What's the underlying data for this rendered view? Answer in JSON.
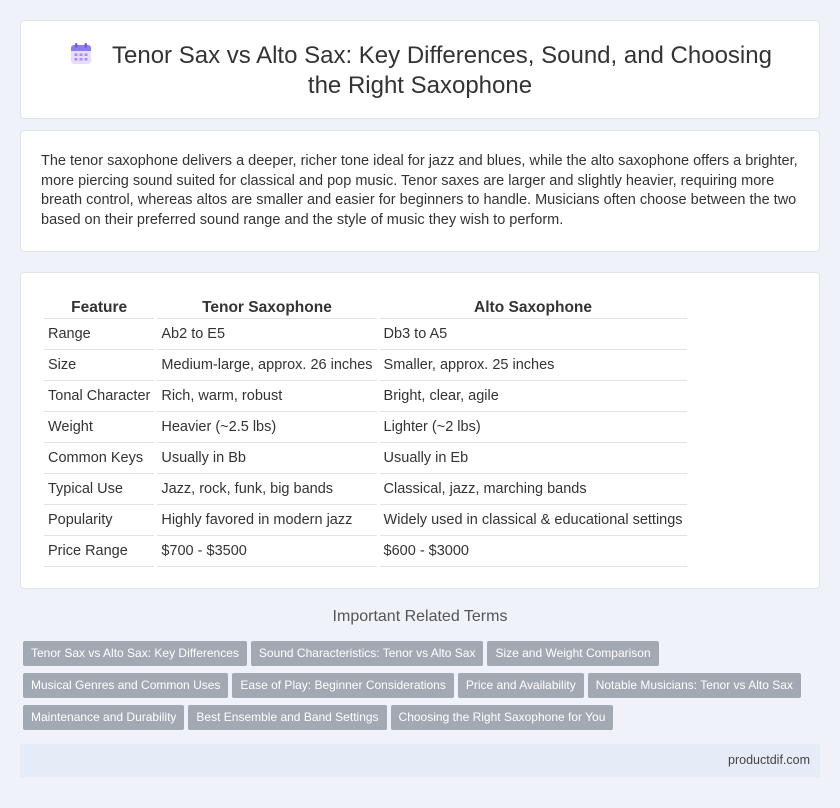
{
  "title": "Tenor Sax vs Alto Sax: Key Differences, Sound, and Choosing the Right Saxophone",
  "intro": "The tenor saxophone delivers a deeper, richer tone ideal for jazz and blues, while the alto saxophone offers a brighter, more piercing sound suited for classical and pop music. Tenor saxes are larger and slightly heavier, requiring more breath control, whereas altos are smaller and easier for beginners to handle. Musicians often choose between the two based on their preferred sound range and the style of music they wish to perform.",
  "table": {
    "headers": [
      "Feature",
      "Tenor Saxophone",
      "Alto Saxophone"
    ],
    "rows": [
      [
        "Range",
        "Ab2 to E5",
        "Db3 to A5"
      ],
      [
        "Size",
        "Medium-large, approx. 26 inches",
        "Smaller, approx. 25 inches"
      ],
      [
        "Tonal Character",
        "Rich, warm, robust",
        "Bright, clear, agile"
      ],
      [
        "Weight",
        "Heavier (~2.5 lbs)",
        "Lighter (~2 lbs)"
      ],
      [
        "Common Keys",
        "Usually in Bb",
        "Usually in Eb"
      ],
      [
        "Typical Use",
        "Jazz, rock, funk, big bands",
        "Classical, jazz, marching bands"
      ],
      [
        "Popularity",
        "Highly favored in modern jazz",
        "Widely used in classical & educational settings"
      ],
      [
        "Price Range",
        "$700 - $3500",
        "$600 - $3000"
      ]
    ]
  },
  "related": {
    "heading": "Important Related Terms",
    "rows": [
      [
        "Tenor Sax vs Alto Sax: Key Differences",
        "Sound Characteristics: Tenor vs Alto Sax",
        "Size and Weight Comparison"
      ],
      [
        "Musical Genres and Common Uses",
        "Ease of Play: Beginner Considerations",
        "Price and Availability",
        "Notable Musicians: Tenor vs Alto Sax"
      ],
      [
        "Maintenance and Durability",
        "Best Ensemble and Band Settings",
        "Choosing the Right Saxophone for You"
      ]
    ]
  },
  "footer": "productdif.com",
  "icon": "calendar-icon"
}
